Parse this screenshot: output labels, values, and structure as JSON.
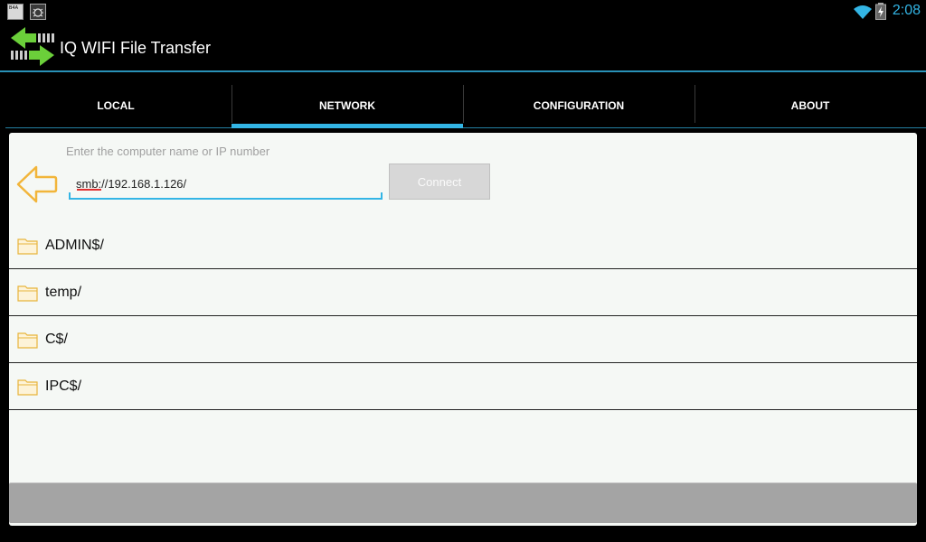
{
  "status_bar": {
    "time": "2:08",
    "left_icons": [
      "basic4android-icon",
      "bug-icon"
    ],
    "right_icons": [
      "wifi-icon",
      "battery-charging-icon"
    ],
    "accent_color": "#33b5e5"
  },
  "action_bar": {
    "title": "IQ WIFI File Transfer",
    "logo_icon": "transfer-arrows-icon"
  },
  "tabs": [
    {
      "label": "LOCAL",
      "active": false
    },
    {
      "label": "NETWORK",
      "active": true
    },
    {
      "label": "CONFIGURATION",
      "active": false
    },
    {
      "label": "ABOUT",
      "active": false
    }
  ],
  "network": {
    "hint": "Enter the computer name or IP number",
    "address_value": "smb://192.168.1.126/",
    "connect_label": "Connect",
    "back_icon": "back-arrow-icon"
  },
  "folders": [
    {
      "name": "ADMIN$/",
      "icon": "folder-icon"
    },
    {
      "name": "temp/",
      "icon": "folder-icon"
    },
    {
      "name": "C$/",
      "icon": "folder-icon"
    },
    {
      "name": "IPC$/",
      "icon": "folder-icon"
    }
  ]
}
